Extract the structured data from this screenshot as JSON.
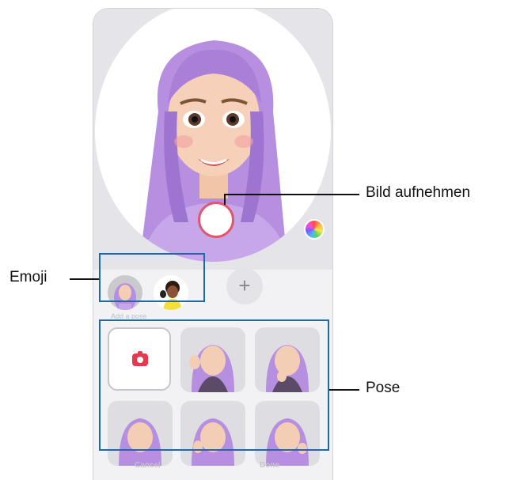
{
  "annotations": {
    "capture_label": "Bild aufnehmen",
    "emoji_label": "Emoji",
    "pose_label": "Pose"
  },
  "screen": {
    "add_emoji_icon": "plus-icon",
    "add_label": "Add a pose",
    "cancel_label": "Cancel",
    "done_label": "Done"
  },
  "colors": {
    "highlight": "#1d6aa5",
    "capture_ring": "#e0576d",
    "camera_icon": "#e8384f",
    "avatar_hair": "#b890dc"
  }
}
